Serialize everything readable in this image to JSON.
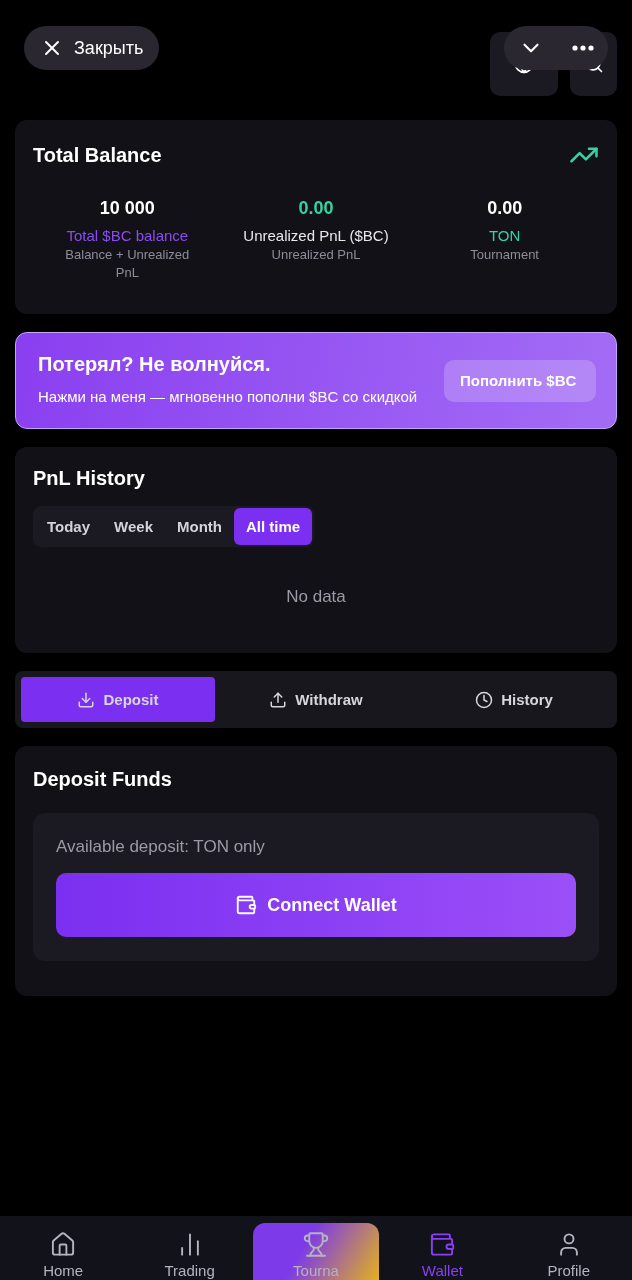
{
  "overlay": {
    "close": {
      "label": "Закрыть"
    }
  },
  "balance": {
    "title": "Total Balance",
    "stats": [
      {
        "kind": "balance",
        "value": "10 000",
        "label": "Total $BC balance",
        "caption": "Balance + Unrealized PnL"
      },
      {
        "kind": "pnl",
        "value": "0.00",
        "label": "Unrealized PnL ($BC)",
        "caption": "Unrealized PnL"
      },
      {
        "kind": "ton",
        "value": "0.00",
        "label": "TON",
        "caption": "Tournament"
      }
    ]
  },
  "promo": {
    "title": "Потерял? Не волнуйся.",
    "text": "Нажми на меня — мгновенно пополни $BC со скидкой",
    "button": "Пополнить $BC"
  },
  "pnl_history": {
    "title": "PnL History",
    "periods": [
      {
        "label": "Today",
        "selected": false
      },
      {
        "label": "Week",
        "selected": false
      },
      {
        "label": "Month",
        "selected": false
      },
      {
        "label": "All time",
        "selected": true
      }
    ],
    "empty": "No data"
  },
  "actions": [
    {
      "kind": "deposit",
      "label": "Deposit",
      "selected": true
    },
    {
      "kind": "withdraw",
      "label": "Withdraw",
      "selected": false
    },
    {
      "kind": "history",
      "label": "History",
      "selected": false
    }
  ],
  "deposit": {
    "title": "Deposit Funds",
    "note": "Available deposit: TON only",
    "button": "Connect Wallet"
  },
  "nav": [
    {
      "kind": "home",
      "label": "Home",
      "selected": false
    },
    {
      "kind": "trading",
      "label": "Trading",
      "selected": false
    },
    {
      "kind": "tournament",
      "label": "Tourna",
      "selected": false
    },
    {
      "kind": "wallet",
      "label": "Wallet",
      "selected": true
    },
    {
      "kind": "profile",
      "label": "Profile",
      "selected": false
    }
  ]
}
